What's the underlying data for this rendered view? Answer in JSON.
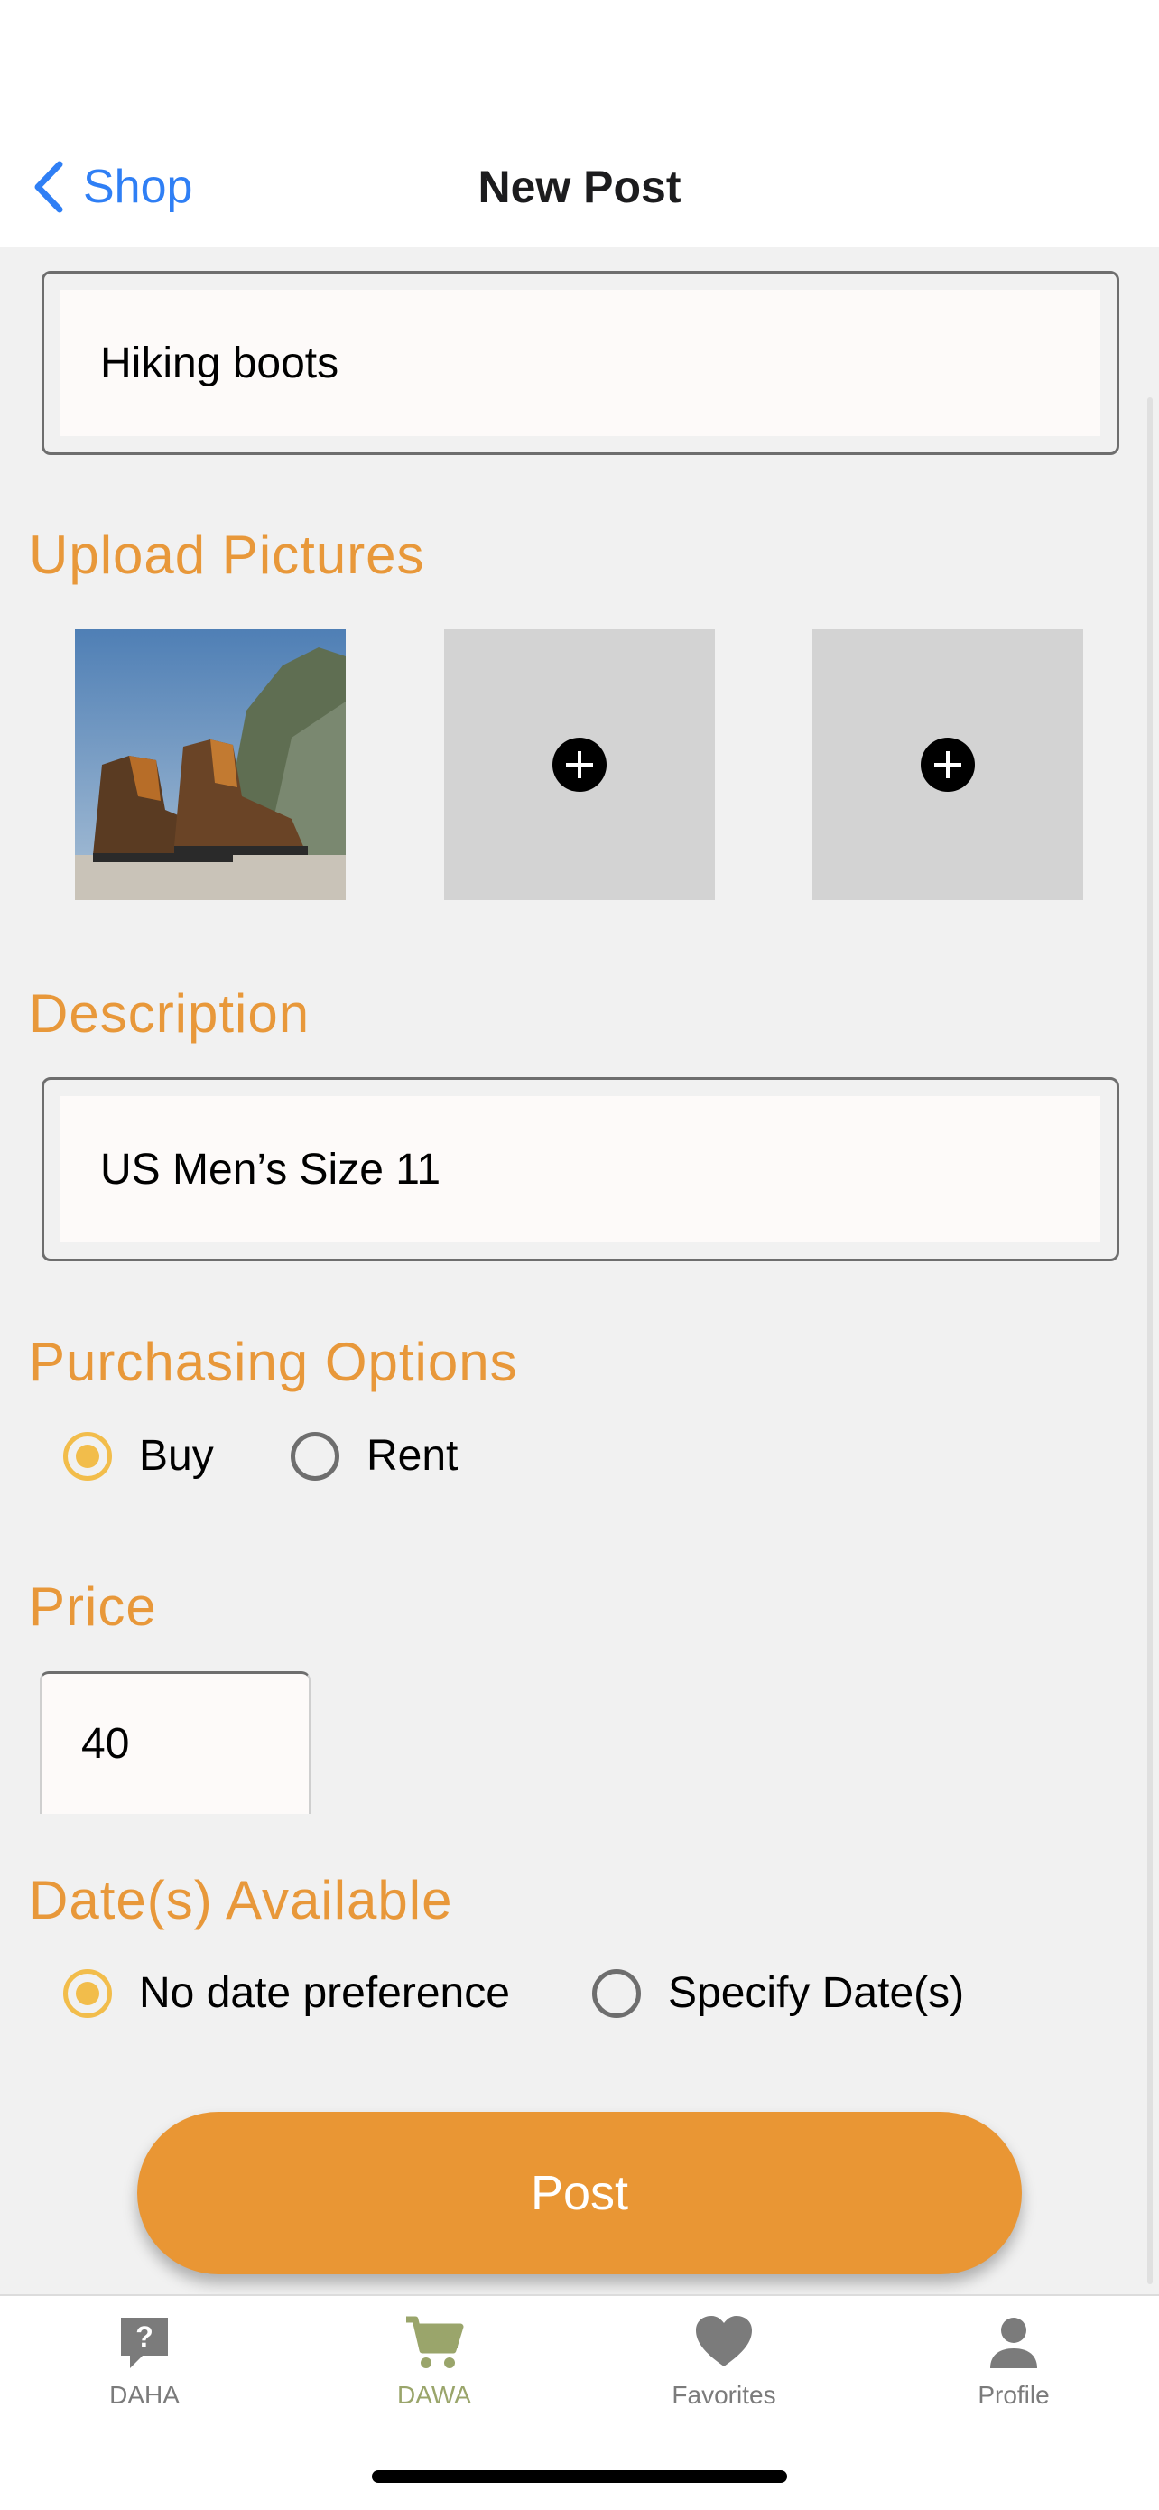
{
  "nav": {
    "back_label": "Shop",
    "title": "New Post"
  },
  "title_field": {
    "value": "Hiking boots"
  },
  "upload": {
    "heading": "Upload Pictures"
  },
  "description": {
    "heading": "Description",
    "value": "US Men’s Size 11"
  },
  "purchasing": {
    "heading": "Purchasing Options",
    "options": [
      "Buy",
      "Rent"
    ],
    "selected": "Buy"
  },
  "price": {
    "heading": "Price",
    "value": "40"
  },
  "dates": {
    "heading": "Date(s) Available",
    "options": [
      "No date preference",
      "Specify Date(s)"
    ],
    "selected": "No date preference"
  },
  "post_button": {
    "label": "Post"
  },
  "tabbar": {
    "items": [
      {
        "label": "DAHA",
        "icon": "question-bubble-icon"
      },
      {
        "label": "DAWA",
        "icon": "cart-icon",
        "active": true
      },
      {
        "label": "Favorites",
        "icon": "heart-icon"
      },
      {
        "label": "Profile",
        "icon": "person-icon"
      }
    ]
  },
  "colors": {
    "accent": "#e8983a",
    "link": "#2f7ff5",
    "radio": "#f2bd4b",
    "tab_active": "#9aa56b"
  }
}
